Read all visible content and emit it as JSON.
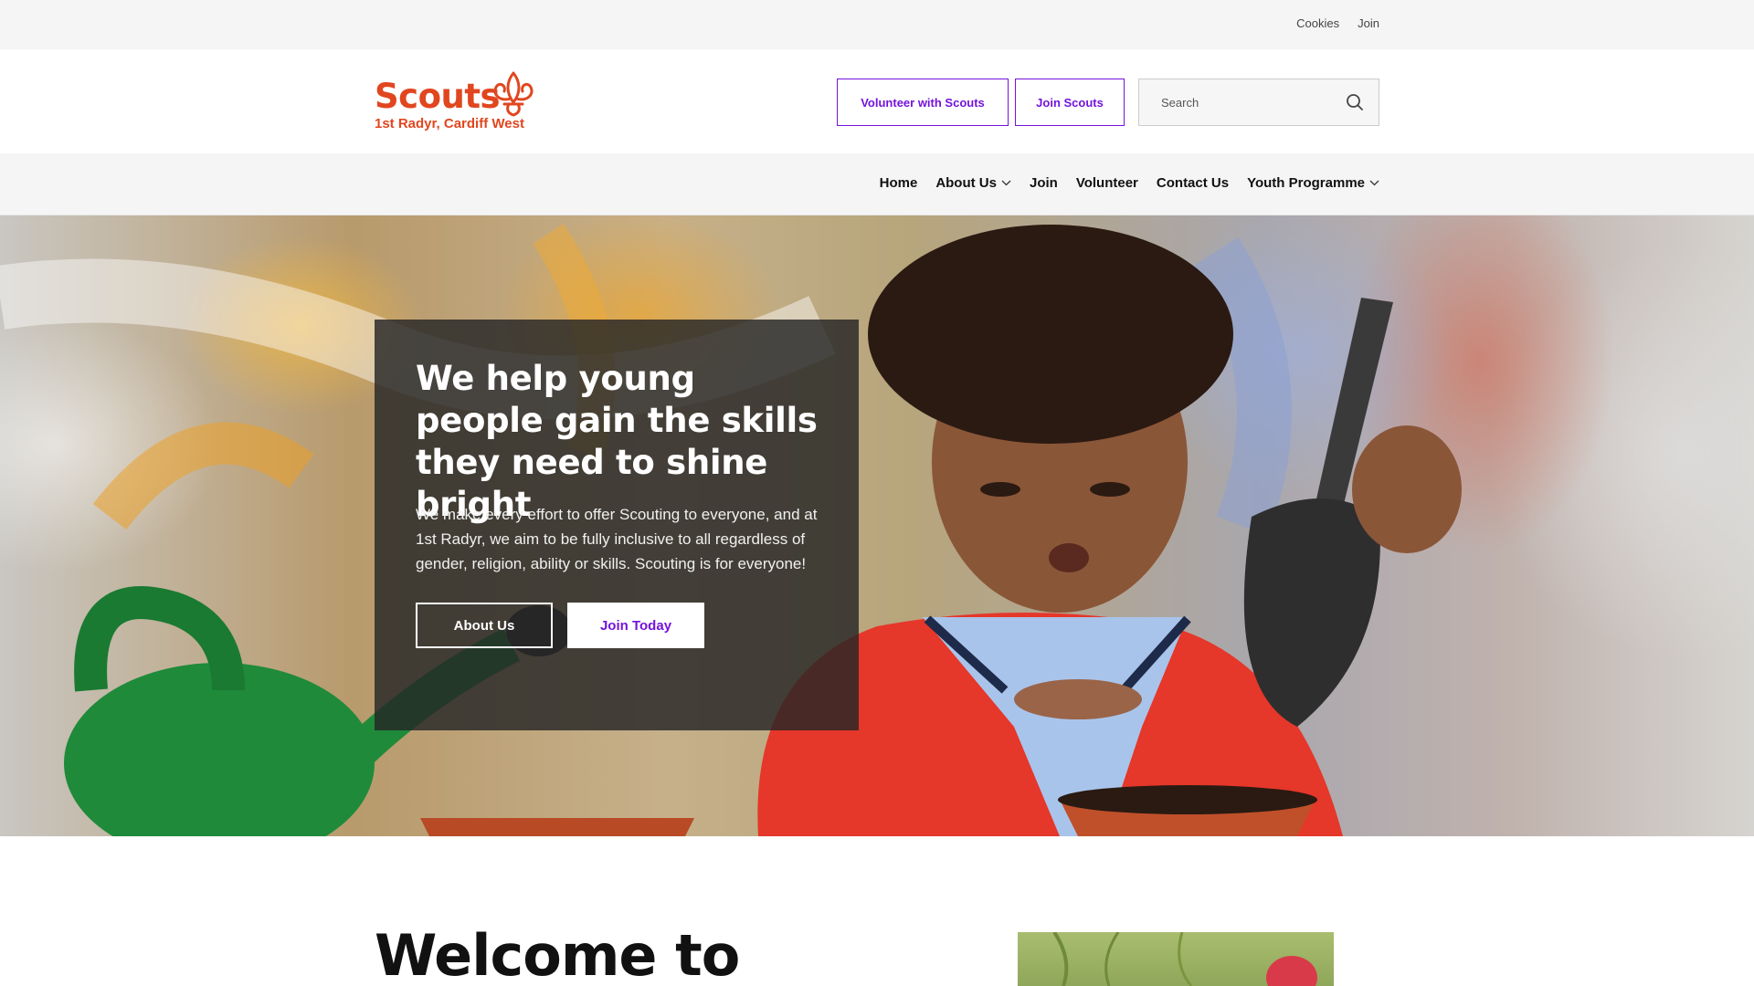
{
  "utility_bar": {
    "links": [
      "Cookies",
      "Join"
    ]
  },
  "header": {
    "logo": {
      "wordmark": "Scouts",
      "group_name": "1st Radyr, Cardiff West"
    },
    "buttons": {
      "volunteer": "Volunteer with Scouts",
      "join": "Join Scouts"
    },
    "search": {
      "placeholder": "Search",
      "icon": "search-icon"
    }
  },
  "nav": {
    "items": [
      {
        "label": "Home",
        "has_dropdown": false
      },
      {
        "label": "About Us",
        "has_dropdown": true
      },
      {
        "label": "Join",
        "has_dropdown": false
      },
      {
        "label": "Volunteer",
        "has_dropdown": false
      },
      {
        "label": "Contact Us",
        "has_dropdown": false
      },
      {
        "label": "Youth Programme",
        "has_dropdown": true
      }
    ]
  },
  "hero": {
    "title": "We help young people gain the skills they need to shine bright",
    "text": "We make every effort to offer Scouting to everyone, and at 1st Radyr, we aim to be fully inclusive to all regardless of gender, religion, ability or skills. Scouting is for everyone!",
    "buttons": {
      "about": "About Us",
      "join": "Join Today"
    }
  },
  "welcome": {
    "title": "Welcome to"
  },
  "colors": {
    "brand_orange": "#e1461f",
    "brand_purple": "#7413dc",
    "hero_card": "#262626",
    "bar_grey": "#f5f5f5"
  }
}
